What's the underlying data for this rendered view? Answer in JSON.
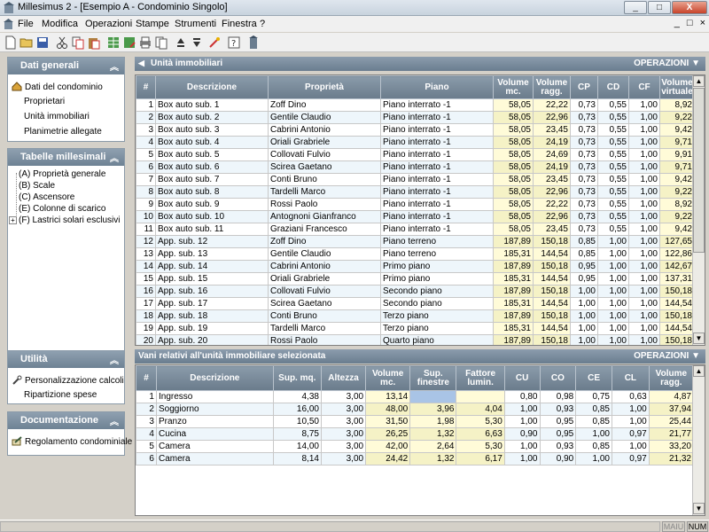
{
  "window": {
    "title": "Millesimus 2 - [Esempio A - Condominio Singolo]",
    "min": "_",
    "max": "□",
    "close": "X"
  },
  "menu": [
    "File",
    "Modifica",
    "Operazioni",
    "Stampe",
    "Strumenti",
    "Finestra",
    "?"
  ],
  "mdi_controls": [
    "_",
    "□",
    "×"
  ],
  "left": {
    "dati_generali": {
      "title": "Dati generali",
      "items": [
        "Dati del condominio",
        "Proprietari",
        "Unità immobiliari",
        "Planimetrie allegate"
      ]
    },
    "tabelle": {
      "title": "Tabelle millesimali",
      "items": [
        "(A) Proprietà generale",
        "(B) Scale",
        "(C) Ascensore",
        "(E) Colonne di scarico",
        "(F) Lastrici solari esclusivi"
      ]
    },
    "utilita": {
      "title": "Utilità",
      "items": [
        "Personalizzazione calcoli",
        "Ripartizione spese"
      ]
    },
    "documentazione": {
      "title": "Documentazione",
      "items": [
        "Regolamento condominiale"
      ]
    }
  },
  "units": {
    "title": "Unità immobiliari",
    "operations": "OPERAZIONI",
    "columns": [
      "#",
      "Descrizione",
      "Proprietà",
      "Piano",
      "Volume mc.",
      "Volume ragg.",
      "CP",
      "CD",
      "CF",
      "Volume virtuale"
    ],
    "rows": [
      [
        "1",
        "Box auto sub. 1",
        "Zoff Dino",
        "Piano interrato -1",
        "58,05",
        "22,22",
        "0,73",
        "0,55",
        "1,00",
        "8,92"
      ],
      [
        "2",
        "Box auto sub. 2",
        "Gentile Claudio",
        "Piano interrato -1",
        "58,05",
        "22,96",
        "0,73",
        "0,55",
        "1,00",
        "9,22"
      ],
      [
        "3",
        "Box auto sub. 3",
        "Cabrini Antonio",
        "Piano interrato -1",
        "58,05",
        "23,45",
        "0,73",
        "0,55",
        "1,00",
        "9,42"
      ],
      [
        "4",
        "Box auto sub. 4",
        "Oriali Grabriele",
        "Piano interrato -1",
        "58,05",
        "24,19",
        "0,73",
        "0,55",
        "1,00",
        "9,71"
      ],
      [
        "5",
        "Box auto sub. 5",
        "Collovati Fulvio",
        "Piano interrato -1",
        "58,05",
        "24,69",
        "0,73",
        "0,55",
        "1,00",
        "9,91"
      ],
      [
        "6",
        "Box auto sub. 6",
        "Scirea Gaetano",
        "Piano interrato -1",
        "58,05",
        "24,19",
        "0,73",
        "0,55",
        "1,00",
        "9,71"
      ],
      [
        "7",
        "Box auto sub. 7",
        "Conti Bruno",
        "Piano interrato -1",
        "58,05",
        "23,45",
        "0,73",
        "0,55",
        "1,00",
        "9,42"
      ],
      [
        "8",
        "Box auto sub. 8",
        "Tardelli Marco",
        "Piano interrato -1",
        "58,05",
        "22,96",
        "0,73",
        "0,55",
        "1,00",
        "9,22"
      ],
      [
        "9",
        "Box auto sub. 9",
        "Rossi Paolo",
        "Piano interrato -1",
        "58,05",
        "22,22",
        "0,73",
        "0,55",
        "1,00",
        "8,92"
      ],
      [
        "10",
        "Box auto sub. 10",
        "Antognoni Gianfranco",
        "Piano interrato -1",
        "58,05",
        "22,96",
        "0,73",
        "0,55",
        "1,00",
        "9,22"
      ],
      [
        "11",
        "Box auto sub. 11",
        "Graziani Francesco",
        "Piano interrato -1",
        "58,05",
        "23,45",
        "0,73",
        "0,55",
        "1,00",
        "9,42"
      ],
      [
        "12",
        "App. sub. 12",
        "Zoff Dino",
        "Piano terreno",
        "187,89",
        "150,18",
        "0,85",
        "1,00",
        "1,00",
        "127,65"
      ],
      [
        "13",
        "App. sub. 13",
        "Gentile Claudio",
        "Piano terreno",
        "185,31",
        "144,54",
        "0,85",
        "1,00",
        "1,00",
        "122,86"
      ],
      [
        "14",
        "App. sub. 14",
        "Cabrini Antonio",
        "Primo piano",
        "187,89",
        "150,18",
        "0,95",
        "1,00",
        "1,00",
        "142,67"
      ],
      [
        "15",
        "App. sub. 15",
        "Oriali Grabriele",
        "Primo piano",
        "185,31",
        "144,54",
        "0,95",
        "1,00",
        "1,00",
        "137,31"
      ],
      [
        "16",
        "App. sub. 16",
        "Collovati Fulvio",
        "Secondo piano",
        "187,89",
        "150,18",
        "1,00",
        "1,00",
        "1,00",
        "150,18"
      ],
      [
        "17",
        "App. sub. 17",
        "Scirea Gaetano",
        "Secondo piano",
        "185,31",
        "144,54",
        "1,00",
        "1,00",
        "1,00",
        "144,54"
      ],
      [
        "18",
        "App. sub. 18",
        "Conti Bruno",
        "Terzo piano",
        "187,89",
        "150,18",
        "1,00",
        "1,00",
        "1,00",
        "150,18"
      ],
      [
        "19",
        "App. sub. 19",
        "Tardelli Marco",
        "Terzo piano",
        "185,31",
        "144,54",
        "1,00",
        "1,00",
        "1,00",
        "144,54"
      ],
      [
        "20",
        "App. sub. 20",
        "Rossi Paolo",
        "Quarto piano",
        "187,89",
        "150,18",
        "1,00",
        "1,00",
        "1,00",
        "150,18"
      ]
    ]
  },
  "rooms": {
    "title": "Vani relativi all'unità immobiliare selezionata",
    "operations": "OPERAZIONI",
    "columns": [
      "#",
      "Descrizione",
      "Sup. mq.",
      "Altezza",
      "Volume mc.",
      "Sup. finestre",
      "Fattore lumin.",
      "CU",
      "CO",
      "CE",
      "CL",
      "Volume ragg."
    ],
    "rows": [
      [
        "1",
        "Ingresso",
        "4,38",
        "3,00",
        "13,14",
        "",
        "",
        "0,80",
        "0,98",
        "0,75",
        "0,63",
        "4,87"
      ],
      [
        "2",
        "Soggiorno",
        "16,00",
        "3,00",
        "48,00",
        "3,96",
        "4,04",
        "1,00",
        "0,93",
        "0,85",
        "1,00",
        "37,94"
      ],
      [
        "3",
        "Pranzo",
        "10,50",
        "3,00",
        "31,50",
        "1,98",
        "5,30",
        "1,00",
        "0,95",
        "0,85",
        "1,00",
        "25,44"
      ],
      [
        "4",
        "Cucina",
        "8,75",
        "3,00",
        "26,25",
        "1,32",
        "6,63",
        "0,90",
        "0,95",
        "1,00",
        "0,97",
        "21,77"
      ],
      [
        "5",
        "Camera",
        "14,00",
        "3,00",
        "42,00",
        "2,64",
        "5,30",
        "1,00",
        "0,93",
        "0,85",
        "1,00",
        "33,20"
      ],
      [
        "6",
        "Camera",
        "8,14",
        "3,00",
        "24,42",
        "1,32",
        "6,17",
        "1,00",
        "0,90",
        "1,00",
        "0,97",
        "21,32"
      ]
    ]
  },
  "status": {
    "maiu": "MAIU",
    "num": "NUM"
  },
  "colors": {
    "header": "#6a7d8f",
    "volume_bg": "#fffbd8",
    "alt_row": "#eef6fb",
    "selected": "#a9c4e6"
  }
}
